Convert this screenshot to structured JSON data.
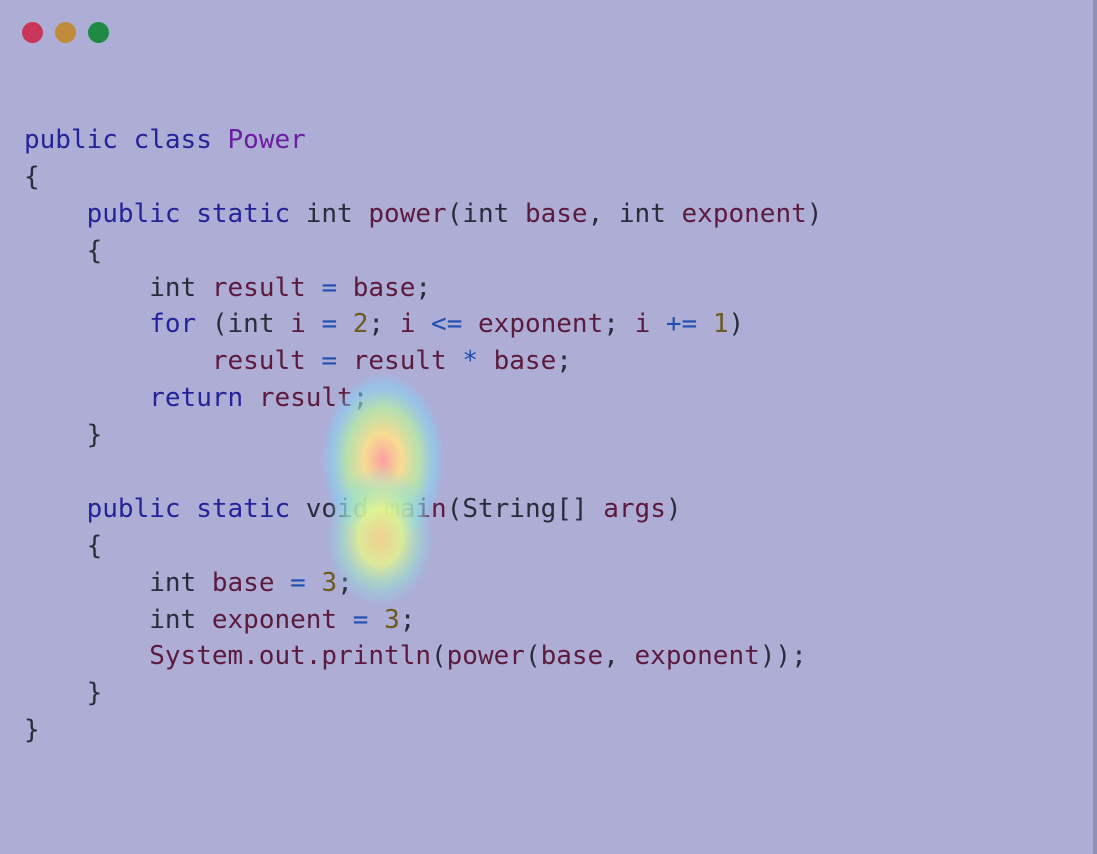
{
  "window": {
    "buttons": [
      {
        "name": "close",
        "color": "#c8365a"
      },
      {
        "name": "minimize",
        "color": "#c08b3a"
      },
      {
        "name": "zoom",
        "color": "#1e8a44"
      }
    ]
  },
  "code_lines": [
    [
      {
        "t": "kw",
        "s": "public"
      },
      {
        "t": "plain",
        "s": " "
      },
      {
        "t": "kw",
        "s": "class"
      },
      {
        "t": "plain",
        "s": " "
      },
      {
        "t": "cls",
        "s": "Power"
      }
    ],
    [
      {
        "t": "pun",
        "s": "{"
      }
    ],
    [
      {
        "t": "plain",
        "s": "    "
      },
      {
        "t": "kw",
        "s": "public"
      },
      {
        "t": "plain",
        "s": " "
      },
      {
        "t": "kw",
        "s": "static"
      },
      {
        "t": "plain",
        "s": " "
      },
      {
        "t": "type",
        "s": "int"
      },
      {
        "t": "plain",
        "s": " "
      },
      {
        "t": "fn",
        "s": "power"
      },
      {
        "t": "pun",
        "s": "("
      },
      {
        "t": "type",
        "s": "int"
      },
      {
        "t": "plain",
        "s": " "
      },
      {
        "t": "var",
        "s": "base"
      },
      {
        "t": "pun",
        "s": ", "
      },
      {
        "t": "type",
        "s": "int"
      },
      {
        "t": "plain",
        "s": " "
      },
      {
        "t": "var",
        "s": "exponent"
      },
      {
        "t": "pun",
        "s": ")"
      }
    ],
    [
      {
        "t": "plain",
        "s": "    "
      },
      {
        "t": "pun",
        "s": "{"
      }
    ],
    [
      {
        "t": "plain",
        "s": "        "
      },
      {
        "t": "type",
        "s": "int"
      },
      {
        "t": "plain",
        "s": " "
      },
      {
        "t": "var",
        "s": "result"
      },
      {
        "t": "plain",
        "s": " "
      },
      {
        "t": "op",
        "s": "="
      },
      {
        "t": "plain",
        "s": " "
      },
      {
        "t": "var",
        "s": "base"
      },
      {
        "t": "pun",
        "s": ";"
      }
    ],
    [
      {
        "t": "plain",
        "s": "        "
      },
      {
        "t": "kw",
        "s": "for"
      },
      {
        "t": "plain",
        "s": " "
      },
      {
        "t": "pun",
        "s": "("
      },
      {
        "t": "type",
        "s": "int"
      },
      {
        "t": "plain",
        "s": " "
      },
      {
        "t": "var",
        "s": "i"
      },
      {
        "t": "plain",
        "s": " "
      },
      {
        "t": "op",
        "s": "="
      },
      {
        "t": "plain",
        "s": " "
      },
      {
        "t": "num",
        "s": "2"
      },
      {
        "t": "pun",
        "s": "; "
      },
      {
        "t": "var",
        "s": "i"
      },
      {
        "t": "plain",
        "s": " "
      },
      {
        "t": "op",
        "s": "<="
      },
      {
        "t": "plain",
        "s": " "
      },
      {
        "t": "var",
        "s": "exponent"
      },
      {
        "t": "pun",
        "s": "; "
      },
      {
        "t": "var",
        "s": "i"
      },
      {
        "t": "plain",
        "s": " "
      },
      {
        "t": "op",
        "s": "+="
      },
      {
        "t": "plain",
        "s": " "
      },
      {
        "t": "num",
        "s": "1"
      },
      {
        "t": "pun",
        "s": ")"
      }
    ],
    [
      {
        "t": "plain",
        "s": "            "
      },
      {
        "t": "var",
        "s": "result"
      },
      {
        "t": "plain",
        "s": " "
      },
      {
        "t": "op",
        "s": "="
      },
      {
        "t": "plain",
        "s": " "
      },
      {
        "t": "var",
        "s": "result"
      },
      {
        "t": "plain",
        "s": " "
      },
      {
        "t": "op",
        "s": "*"
      },
      {
        "t": "plain",
        "s": " "
      },
      {
        "t": "var",
        "s": "base"
      },
      {
        "t": "pun",
        "s": ";"
      }
    ],
    [
      {
        "t": "plain",
        "s": "        "
      },
      {
        "t": "kw",
        "s": "return"
      },
      {
        "t": "plain",
        "s": " "
      },
      {
        "t": "var",
        "s": "result"
      },
      {
        "t": "pun",
        "s": ";"
      }
    ],
    [
      {
        "t": "plain",
        "s": "    "
      },
      {
        "t": "pun",
        "s": "}"
      }
    ],
    [
      {
        "t": "plain",
        "s": ""
      }
    ],
    [
      {
        "t": "plain",
        "s": "    "
      },
      {
        "t": "kw",
        "s": "public"
      },
      {
        "t": "plain",
        "s": " "
      },
      {
        "t": "kw",
        "s": "static"
      },
      {
        "t": "plain",
        "s": " "
      },
      {
        "t": "type",
        "s": "void"
      },
      {
        "t": "plain",
        "s": " "
      },
      {
        "t": "fn",
        "s": "main"
      },
      {
        "t": "pun",
        "s": "("
      },
      {
        "t": "type",
        "s": "String"
      },
      {
        "t": "pun",
        "s": "[] "
      },
      {
        "t": "var",
        "s": "args"
      },
      {
        "t": "pun",
        "s": ")"
      }
    ],
    [
      {
        "t": "plain",
        "s": "    "
      },
      {
        "t": "pun",
        "s": "{"
      }
    ],
    [
      {
        "t": "plain",
        "s": "        "
      },
      {
        "t": "type",
        "s": "int"
      },
      {
        "t": "plain",
        "s": " "
      },
      {
        "t": "var",
        "s": "base"
      },
      {
        "t": "plain",
        "s": " "
      },
      {
        "t": "op",
        "s": "="
      },
      {
        "t": "plain",
        "s": " "
      },
      {
        "t": "num",
        "s": "3"
      },
      {
        "t": "pun",
        "s": ";"
      }
    ],
    [
      {
        "t": "plain",
        "s": "        "
      },
      {
        "t": "type",
        "s": "int"
      },
      {
        "t": "plain",
        "s": " "
      },
      {
        "t": "var",
        "s": "exponent"
      },
      {
        "t": "plain",
        "s": " "
      },
      {
        "t": "op",
        "s": "="
      },
      {
        "t": "plain",
        "s": " "
      },
      {
        "t": "num",
        "s": "3"
      },
      {
        "t": "pun",
        "s": ";"
      }
    ],
    [
      {
        "t": "plain",
        "s": "        "
      },
      {
        "t": "fn",
        "s": "System.out.println"
      },
      {
        "t": "pun",
        "s": "("
      },
      {
        "t": "fn",
        "s": "power"
      },
      {
        "t": "pun",
        "s": "("
      },
      {
        "t": "var",
        "s": "base"
      },
      {
        "t": "pun",
        "s": ", "
      },
      {
        "t": "var",
        "s": "exponent"
      },
      {
        "t": "pun",
        "s": "));"
      }
    ],
    [
      {
        "t": "plain",
        "s": "    "
      },
      {
        "t": "pun",
        "s": "}"
      }
    ],
    [
      {
        "t": "pun",
        "s": "}"
      }
    ]
  ]
}
